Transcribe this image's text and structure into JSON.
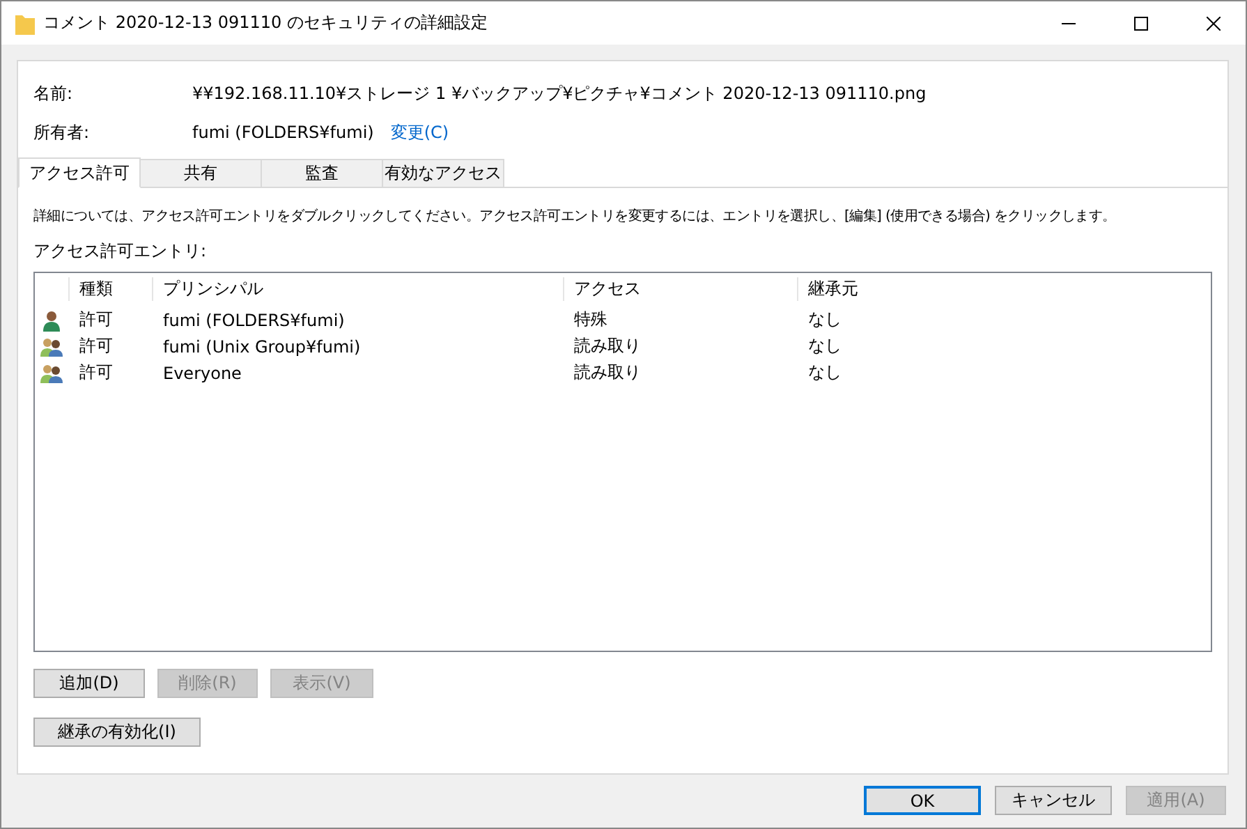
{
  "window": {
    "title": "コメント 2020-12-13 091110 のセキュリティの詳細設定"
  },
  "info": {
    "name_label": "名前:",
    "name_value": "¥¥192.168.11.10¥ストレージ 1 ¥バックアップ¥ピクチャ¥コメント 2020-12-13 091110.png",
    "owner_label": "所有者:",
    "owner_value": "fumi (FOLDERS¥fumi)",
    "owner_link": "変更(C)"
  },
  "tabs": [
    {
      "label": "アクセス許可",
      "selected": true
    },
    {
      "label": "共有",
      "selected": false
    },
    {
      "label": "監査",
      "selected": false
    },
    {
      "label": "有効なアクセス",
      "selected": false
    }
  ],
  "description": "詳細については、アクセス許可エントリをダブルクリックしてください。アクセス許可エントリを変更するには、エントリを選択し、[編集] (使用できる場合) をクリックします。",
  "entries_label": "アクセス許可エントリ:",
  "table": {
    "columns": [
      "種類",
      "プリンシパル",
      "アクセス",
      "継承元"
    ],
    "rows": [
      {
        "kind": "user",
        "type": "許可",
        "principal": "fumi (FOLDERS¥fumi)",
        "access": "特殊",
        "inherited_from": "なし"
      },
      {
        "kind": "group",
        "type": "許可",
        "principal": "fumi (Unix Group¥fumi)",
        "access": "読み取り",
        "inherited_from": "なし"
      },
      {
        "kind": "group",
        "type": "許可",
        "principal": "Everyone",
        "access": "読み取り",
        "inherited_from": "なし"
      }
    ]
  },
  "entry_buttons": [
    {
      "label": "追加(D)",
      "disabled": false
    },
    {
      "label": "削除(R)",
      "disabled": true
    },
    {
      "label": "表示(V)",
      "disabled": true
    }
  ],
  "inheritance_button": {
    "label": "継承の有効化(I)",
    "disabled": false
  },
  "dialog_buttons": [
    {
      "label": "OK",
      "disabled": false,
      "default": true
    },
    {
      "label": "キャンセル",
      "disabled": false,
      "default": false
    },
    {
      "label": "適用(A)",
      "disabled": true,
      "default": false
    }
  ]
}
